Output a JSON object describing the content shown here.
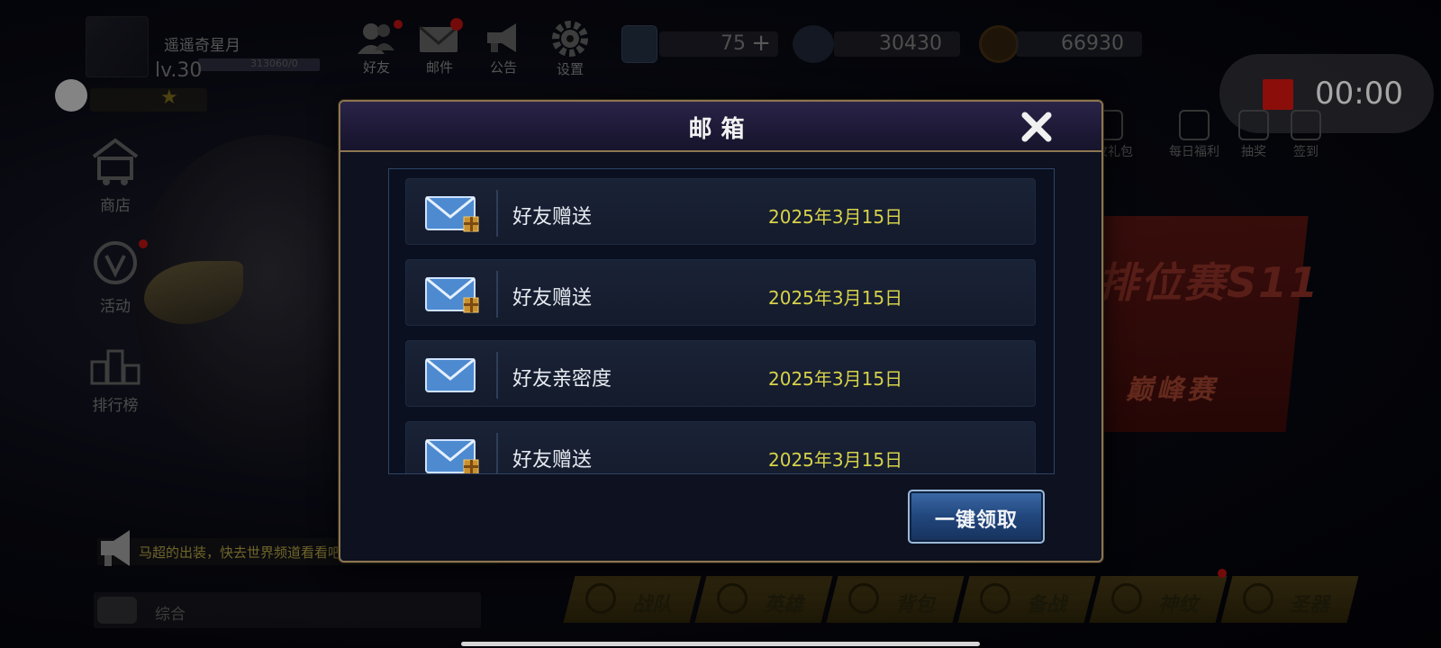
{
  "player": {
    "name": "遥遥奇星月",
    "level": "lv.30",
    "exp": "313060/0"
  },
  "top_icons": [
    {
      "label": "好友",
      "icon": "friends-icon"
    },
    {
      "label": "邮件",
      "icon": "mail-icon"
    },
    {
      "label": "公告",
      "icon": "announcement-icon"
    },
    {
      "label": "设置",
      "icon": "gear-icon"
    }
  ],
  "currencies": [
    {
      "value": "75",
      "icon": "card-icon",
      "plus": "+"
    },
    {
      "value": "30430",
      "icon": "diamond-icon"
    },
    {
      "value": "66930",
      "icon": "gold-coin-icon"
    }
  ],
  "recording": {
    "time": "00:00"
  },
  "right_icons": [
    {
      "label": "神纹礼包"
    },
    {
      "label": "每日福利"
    },
    {
      "label": "抽奖"
    },
    {
      "label": "签到"
    }
  ],
  "sidebar": [
    {
      "label": "商店",
      "icon": "shop-cart-icon"
    },
    {
      "label": "活动",
      "icon": "activity-icon"
    },
    {
      "label": "排行榜",
      "icon": "leaderboard-icon"
    }
  ],
  "background_event": {
    "title": "排位赛S11",
    "subtitle": "巅峰赛"
  },
  "announcement": {
    "text": "马超的出装，快去世界频道看看吧!"
  },
  "chat": {
    "channel": "综合"
  },
  "bottom_tabs": [
    {
      "label": "战队"
    },
    {
      "label": "英雄"
    },
    {
      "label": "背包"
    },
    {
      "label": "备战"
    },
    {
      "label": "神纹"
    },
    {
      "label": "圣器"
    }
  ],
  "mailbox": {
    "title": "邮箱",
    "claim_all_label": "一键领取",
    "mails": [
      {
        "title": "好友赠送",
        "date": "2025年3月15日",
        "has_gift": true
      },
      {
        "title": "好友赠送",
        "date": "2025年3月15日",
        "has_gift": true
      },
      {
        "title": "好友亲密度",
        "date": "2025年3月15日",
        "has_gift": false
      },
      {
        "title": "好友赠送",
        "date": "2025年3月15日",
        "has_gift": true
      }
    ]
  },
  "colors": {
    "date": "#d7d24a",
    "dialog_border": "#8c7550",
    "record": "#c1140e"
  }
}
